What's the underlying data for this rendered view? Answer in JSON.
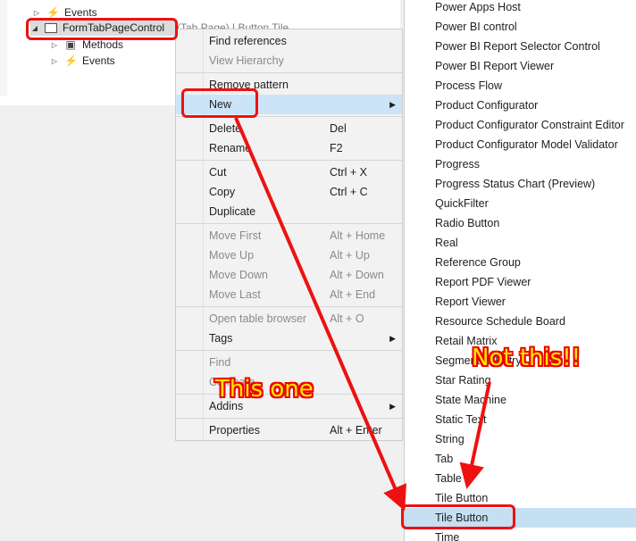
{
  "tree": {
    "top_item": "Events",
    "selected": "FormTabPageControl",
    "selected_suffix": "(Tab Page) | Button Tile",
    "children": [
      "Methods",
      "Events"
    ]
  },
  "menu": {
    "items": [
      {
        "label": "Find references",
        "shortcut": "",
        "disabled": false
      },
      {
        "label": "View Hierarchy",
        "shortcut": "",
        "disabled": true
      },
      {
        "label": "Remove pattern",
        "shortcut": "",
        "disabled": false
      },
      {
        "label": "New",
        "shortcut": "",
        "disabled": false
      },
      {
        "label": "Delete",
        "shortcut": "Del",
        "disabled": false
      },
      {
        "label": "Rename",
        "shortcut": "F2",
        "disabled": false
      },
      {
        "label": "Cut",
        "shortcut": "Ctrl + X",
        "disabled": false
      },
      {
        "label": "Copy",
        "shortcut": "Ctrl + C",
        "disabled": false
      },
      {
        "label": "Duplicate",
        "shortcut": "",
        "disabled": false
      },
      {
        "label": "Move First",
        "shortcut": "Alt + Home",
        "disabled": true
      },
      {
        "label": "Move Up",
        "shortcut": "Alt + Up",
        "disabled": true
      },
      {
        "label": "Move Down",
        "shortcut": "Alt + Down",
        "disabled": true
      },
      {
        "label": "Move Last",
        "shortcut": "Alt + End",
        "disabled": true
      },
      {
        "label": "Open table browser",
        "shortcut": "Alt + O",
        "disabled": true
      },
      {
        "label": "Tags",
        "shortcut": "",
        "disabled": false
      },
      {
        "label": "Find",
        "shortcut": "",
        "disabled": true
      },
      {
        "label": "Compare",
        "shortcut": "",
        "disabled": true
      },
      {
        "label": "Addins",
        "shortcut": "",
        "disabled": false
      },
      {
        "label": "Properties",
        "shortcut": "Alt + Enter",
        "disabled": false
      }
    ]
  },
  "submenu": {
    "items": [
      "Power Apps Host",
      "Power BI control",
      "Power BI Report Selector Control",
      "Power BI Report Viewer",
      "Process Flow",
      "Product Configurator",
      "Product Configurator Constraint Editor",
      "Product Configurator Model Validator",
      "Progress",
      "Progress Status Chart (Preview)",
      "QuickFilter",
      "Radio Button",
      "Real",
      "Reference Group",
      "Report PDF Viewer",
      "Report Viewer",
      "Resource Schedule Board",
      "Retail Matrix",
      "Segmented Entry",
      "Star Rating",
      "State Machine",
      "Static Text",
      "String",
      "Tab",
      "Table",
      "Tile Button",
      "Tile Button",
      "Time"
    ],
    "highlighted_index": 26
  },
  "annotations": {
    "this_one": "This one",
    "not_this": "Not this!!",
    "color": "#ee1111",
    "text_color": "#ffe600"
  },
  "icons": {
    "events": "bolt-icon",
    "form": "form-icon",
    "methods": "cube-icon",
    "expand": "triangle-icon",
    "submenu": "chevron-right-icon"
  }
}
